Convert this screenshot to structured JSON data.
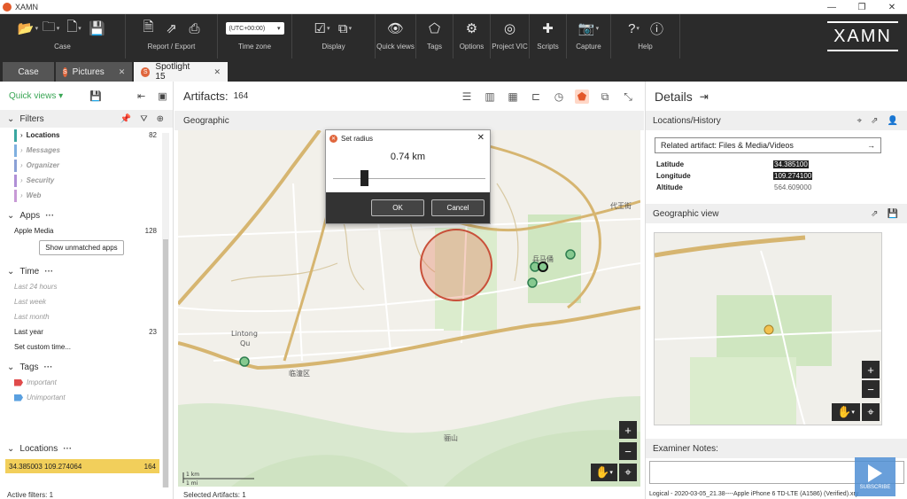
{
  "window": {
    "title": "XAMN",
    "min": "—",
    "max": "❐",
    "close": "✕"
  },
  "ribbon": {
    "groups": [
      {
        "label": "Case",
        "icons": [
          "open-folder-icon",
          "close-folder-icon",
          "new-case-icon",
          "save-icon"
        ]
      },
      {
        "label": "Report / Export",
        "icons": [
          "report-icon",
          "export-icon",
          "print-icon"
        ]
      },
      {
        "label": "Time zone",
        "value": "(UTC+00:00)"
      },
      {
        "label": "Display",
        "icons": [
          "display-icon",
          "display-copy-icon"
        ]
      },
      {
        "label": "Quick views",
        "icons": [
          "eye-icon"
        ]
      },
      {
        "label": "Tags",
        "icons": [
          "tag-icon"
        ]
      },
      {
        "label": "Options",
        "icons": [
          "gear-icon"
        ]
      },
      {
        "label": "Project VIC",
        "icons": [
          "fingerprint-icon"
        ]
      },
      {
        "label": "Scripts",
        "icons": [
          "puzzle-icon"
        ]
      },
      {
        "label": "Capture",
        "icons": [
          "camera-icon"
        ]
      },
      {
        "label": "Help",
        "icons": [
          "help-icon",
          "info-icon"
        ]
      }
    ],
    "logo": "XAMN"
  },
  "tabs": [
    {
      "label": "Case",
      "active": false
    },
    {
      "label": "Pictures",
      "active": false
    },
    {
      "label": "Spotlight 15",
      "active": true
    }
  ],
  "left": {
    "quick_views": "Quick views",
    "filters_label": "Filters",
    "filters": [
      {
        "label": "Locations",
        "count": "82",
        "color": "#3aa6a0",
        "enabled": true
      },
      {
        "label": "Messages",
        "count": "",
        "color": "#7fb0e0",
        "enabled": false
      },
      {
        "label": "Organizer",
        "count": "",
        "color": "#8aa0d6",
        "enabled": false
      },
      {
        "label": "Security",
        "count": "",
        "color": "#b08fd6",
        "enabled": false
      },
      {
        "label": "Web",
        "count": "",
        "color": "#c89ad6",
        "enabled": false
      }
    ],
    "apps_label": "Apps",
    "apps": [
      {
        "label": "Apple Media",
        "count": "128"
      }
    ],
    "show_unmatched": "Show unmatched apps",
    "time_label": "Time",
    "time": [
      {
        "label": "Last 24 hours",
        "count": "",
        "enabled": false
      },
      {
        "label": "Last week",
        "count": "",
        "enabled": false
      },
      {
        "label": "Last month",
        "count": "",
        "enabled": false
      },
      {
        "label": "Last year",
        "count": "23",
        "enabled": true
      },
      {
        "label": "Set custom time...",
        "count": "",
        "enabled": true
      }
    ],
    "tags_label": "Tags",
    "tags": [
      {
        "label": "Important",
        "color": "#e04b4b"
      },
      {
        "label": "Unimportant",
        "color": "#5aa0e0"
      }
    ],
    "locations_label": "Locations",
    "location_selected": {
      "label": "34.385003 109.274064",
      "count": "164"
    },
    "active_filters": "Active filters: 1"
  },
  "center": {
    "title": "Artifacts:",
    "count": "164",
    "subheader": "Geographic",
    "selected": "Selected Artifacts: 1",
    "map_labels": [
      "代王街",
      "Lintong",
      "Qu",
      "临潼区",
      "兵马俑",
      "骊山"
    ],
    "scale": {
      "km": "1 km",
      "mi": "1 mi"
    }
  },
  "dialog": {
    "title": "Set radius",
    "value": "0.74 km",
    "slider_value": 0.2,
    "ok": "OK",
    "cancel": "Cancel"
  },
  "right": {
    "title": "Details",
    "section_location": "Locations/History",
    "related": "Related artifact: Files & Media/Videos",
    "latitude_label": "Latitude",
    "latitude": "34.385100",
    "longitude_label": "Longitude",
    "longitude": "109.274100",
    "altitude_label": "Altitude",
    "altitude": "564.609000",
    "section_geo": "Geographic view",
    "section_notes": "Examiner Notes:",
    "status": "Logical - 2020-03-05_21.38----Apple iPhone 6 TD-LTE (A1586) (Verified).xry",
    "subscribe": "SUBSCRIBE"
  }
}
